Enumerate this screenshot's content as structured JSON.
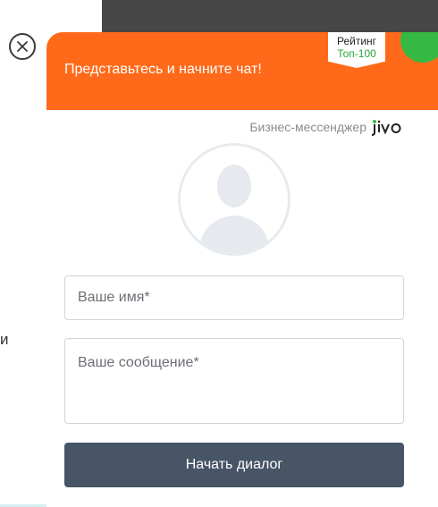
{
  "background": {
    "left_text": "и"
  },
  "header": {
    "title": "Представьтесь и начните чат!",
    "color": "#ff6a1a"
  },
  "rating": {
    "title": "Рейтинг",
    "subtitle": "Топ-100"
  },
  "brand": {
    "label": "Бизнес-мессенджер",
    "logo": "jivo"
  },
  "form": {
    "name_placeholder": "Ваше имя*",
    "message_placeholder": "Ваше сообщение*",
    "submit_label": "Начать диалог",
    "submit_color": "#485567"
  },
  "icons": {
    "close": "close-icon",
    "avatar": "user-avatar-icon"
  }
}
